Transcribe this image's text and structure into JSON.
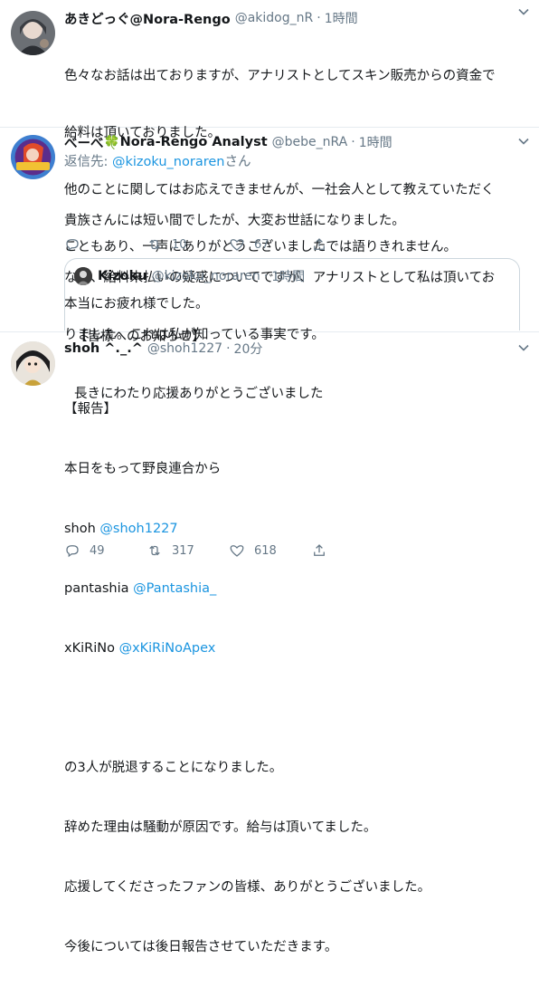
{
  "tweets": [
    {
      "name": "あきどっぐ@Nora-Rengo",
      "handle": "@akidog_nR",
      "dot": "·",
      "time": "1時間",
      "lines": [
        "色々なお話は出ておりますが、アナリストとしてスキン販売からの資金で",
        "給料は頂いておりました。",
        "他のことに関してはお応えできませんが、一社会人として教えていただく",
        "こともあり、一声にありがとうございましたでは語りきれません。",
        "本当にお疲れ様でした。"
      ]
    },
    {
      "name": "べーべ",
      "name_suffix": "Nora-Rengo Analyst",
      "leaf": "🍀",
      "handle": "@bebe_nRA",
      "dot": "·",
      "time": "1時間",
      "reply_label": "返信先: ",
      "reply_handle": "@kizoku_noraren",
      "reply_suffix": "さん",
      "lines": [
        "貴族さんには短い間でしたが、大変お世話になりました。",
        "なお、給料未払いの疑惑についてですが、アナリストとして私は頂いてお",
        "りました。これは私が知っている事実です。"
      ],
      "replies": "",
      "retweets": "10",
      "likes": "67",
      "quote": {
        "name": "Kizoku",
        "handle": "@kizoku_noraren",
        "dot": "·",
        "time": "1時間",
        "lines": [
          "【皆様へのお知らせ】",
          "長きにわたり応援ありがとうございました"
        ]
      }
    },
    {
      "name": "shoh ^._.^",
      "handle": "@shoh1227",
      "dot": "·",
      "time": "20分",
      "line1": "【報告】",
      "line2": "本日をもって野良連合から",
      "m1_name": "shoh ",
      "m1_handle": "@shoh1227",
      "m2_name": "pantashia ",
      "m2_handle": "@Pantashia_",
      "m3_name": "xKiRiNo ",
      "m3_handle": "@xKiRiNoApex",
      "lines_after": [
        "の3人が脱退することになりました。",
        "辞めた理由は騒動が原因です。給与は頂いてました。",
        "応援してくださったファンの皆様、ありがとうございました。",
        "今後については後日報告させていただきます。"
      ],
      "replies": "49",
      "retweets": "317",
      "likes": "618"
    }
  ],
  "colors": {
    "link": "#1b95e0",
    "muted": "#657786",
    "border": "#e6ecf0"
  }
}
